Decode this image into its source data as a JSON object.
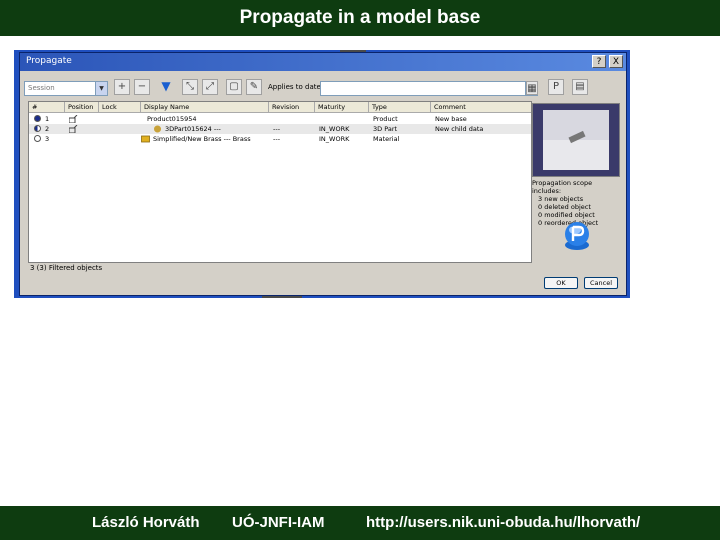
{
  "slide": {
    "title": "Propagate in a model base",
    "footer": {
      "author": "László Horváth",
      "institute": "UÓ-JNFI-IAM",
      "url": "http://users.nik.uni-obuda.hu/lhorvath/"
    }
  },
  "dialog": {
    "title": "Propagate",
    "help_label": "?",
    "close_label": "X",
    "session_combo": "Session",
    "applies_to_label": "Applies to date:",
    "columns": [
      "#",
      "Position",
      "Lock",
      "Display Name",
      "Revision",
      "Maturity",
      "Type",
      "Comment"
    ],
    "rows": [
      {
        "num": "1",
        "position": "",
        "lock": "",
        "display_name": "Product015954",
        "revision": "",
        "maturity": "",
        "type": "Product",
        "comment": "New base",
        "radio": "on",
        "selected": false
      },
      {
        "num": "2",
        "position": "",
        "lock": "",
        "display_name": "3DPart015624 ---",
        "revision": "---",
        "maturity": "IN_WORK",
        "type": "3D Part",
        "comment": "New child data",
        "radio": "half",
        "selected": true
      },
      {
        "num": "3",
        "position": "",
        "lock": "",
        "display_name": "Simplified/New Brass --- Brass",
        "revision": "---",
        "maturity": "IN_WORK",
        "type": "Material",
        "comment": "",
        "radio": "off",
        "selected": false
      }
    ],
    "status_text": "3 (3) Filtered objects",
    "scope": {
      "heading": "Propagation scope includes:",
      "items": [
        "3 new objects",
        "0 deleted object",
        "0 modified object",
        "0 reordered object"
      ]
    },
    "ok_label": "OK",
    "cancel_label": "Cancel"
  },
  "colors": {
    "slide_bar": "#0e3c10",
    "titlebar": "#2b55b8",
    "desktop": "#1f4fbf",
    "selected_row": "#e8e8e8"
  }
}
